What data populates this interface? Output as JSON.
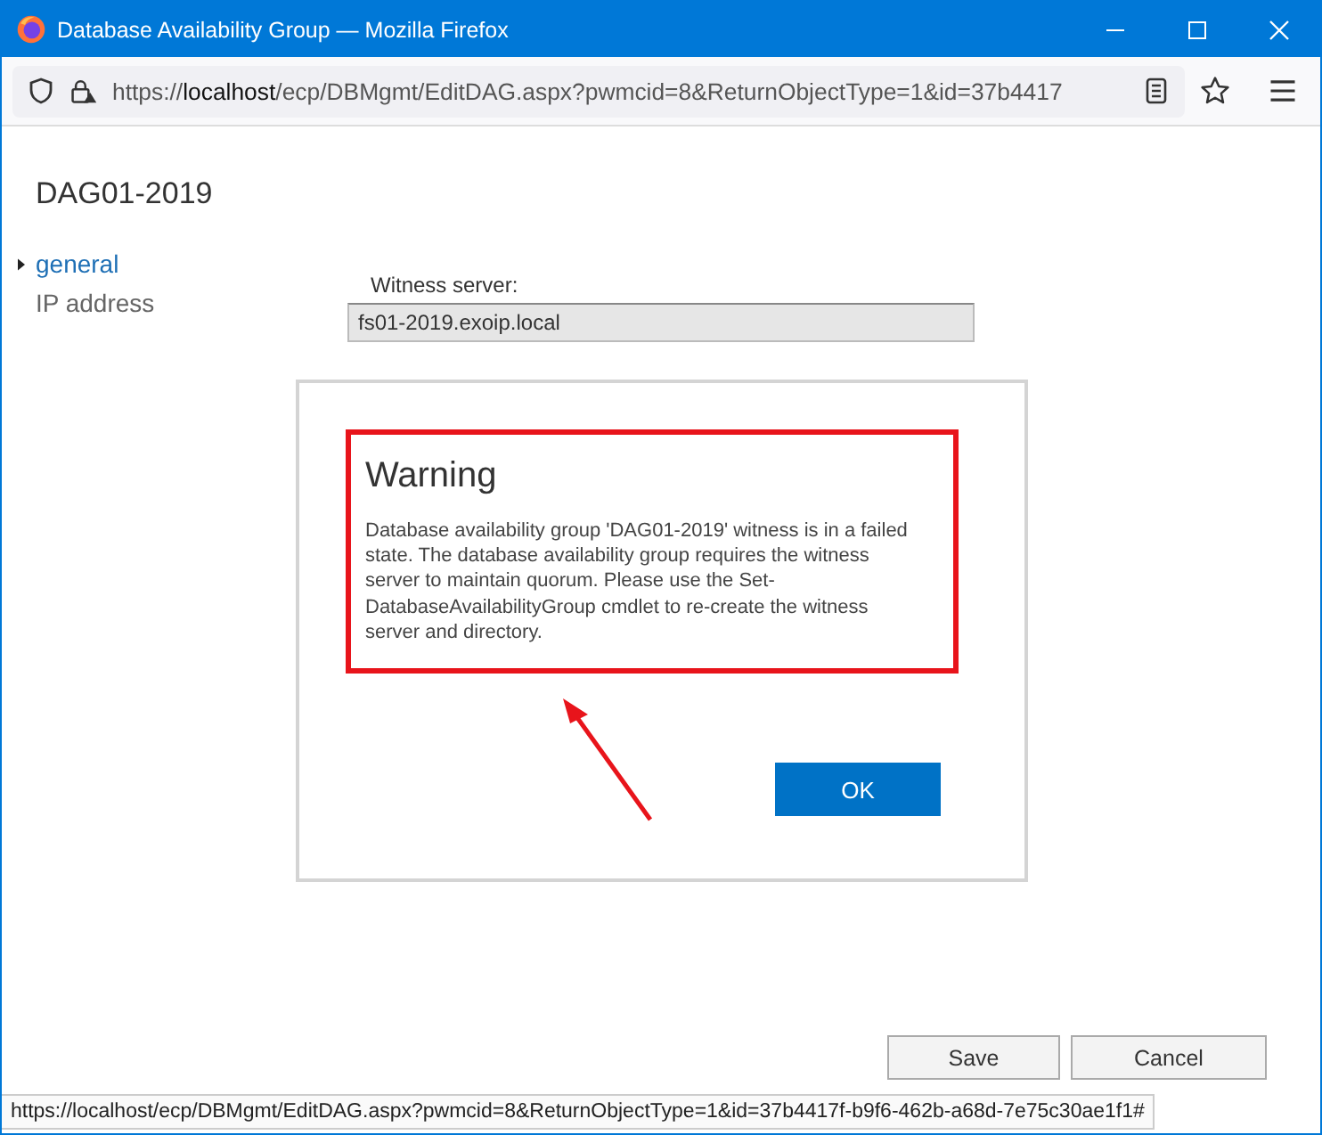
{
  "window": {
    "title": "Database Availability Group — Mozilla Firefox"
  },
  "address_bar": {
    "scheme": "https://",
    "host": "localhost",
    "path": "/ecp/DBMgmt/EditDAG.aspx?pwmcid=8&ReturnObjectType=1&id=37b4417"
  },
  "page": {
    "heading": "DAG01-2019",
    "nav": [
      {
        "label": "general",
        "selected": true
      },
      {
        "label": "IP address",
        "selected": false
      }
    ],
    "fields": [
      {
        "label": "Witness server:",
        "value": "fs01-2019.exoip.local",
        "disabled": true
      }
    ],
    "buttons": [
      "Save",
      "Cancel"
    ]
  },
  "dialog": {
    "title": "Warning",
    "message": "Database availability group 'DAG01-2019' witness is in a failed state. The database availability group requires the witness server to maintain quorum. Please use the Set-DatabaseAvailabilityGroup cmdlet to re-create the witness server and directory.",
    "button": "OK"
  },
  "status_bar": "https://localhost/ecp/DBMgmt/EditDAG.aspx?pwmcid=8&ReturnObjectType=1&id=37b4417f-b9f6-462b-a68d-7e75c30ae1f1#"
}
